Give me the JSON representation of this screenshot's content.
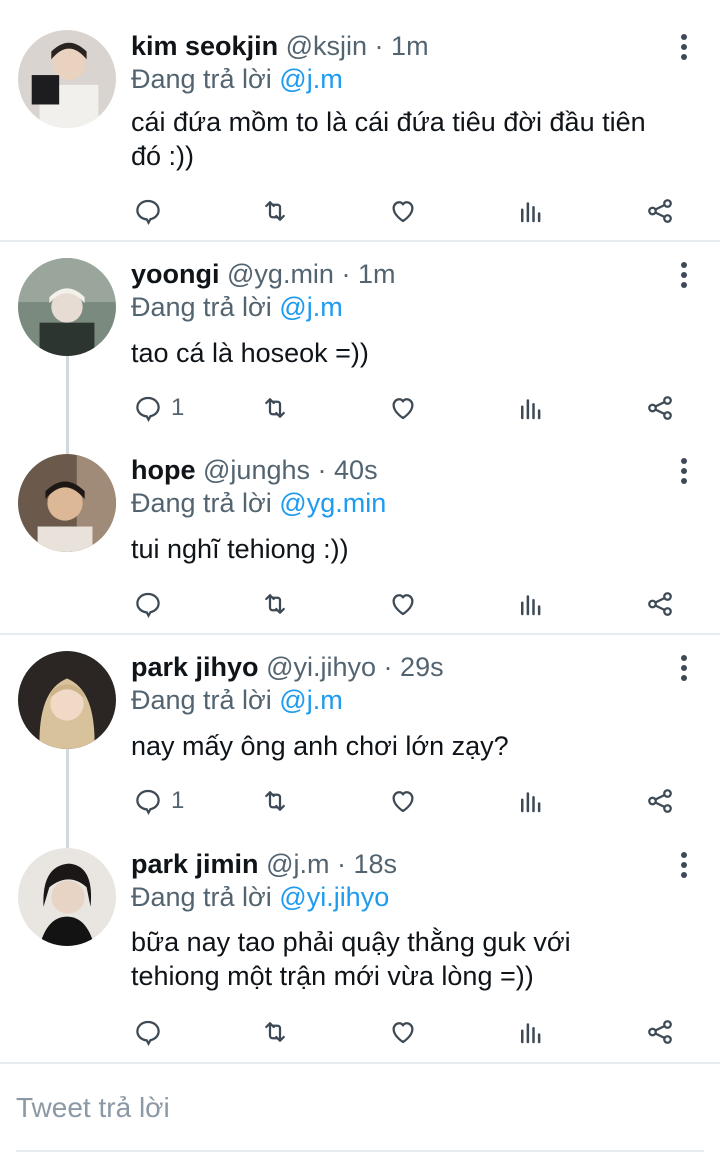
{
  "tweets": [
    {
      "name": "kim seokjin",
      "handle": "@ksjin",
      "time": "1m",
      "replying_prefix": "Đang trả lời",
      "replying_to": "@j.m",
      "body_lines": [
        "cái đứa mồm to là cái đứa tiêu đời đầu tiên",
        "đó :))"
      ],
      "reply_count": ""
    },
    {
      "name": "yoongi",
      "handle": "@yg.min",
      "time": "1m",
      "replying_prefix": "Đang trả lời",
      "replying_to": "@j.m",
      "body_lines": [
        "tao cá là hoseok =))"
      ],
      "reply_count": "1"
    },
    {
      "name": "hope",
      "handle": "@junghs",
      "time": "40s",
      "replying_prefix": "Đang trả lời",
      "replying_to": "@yg.min",
      "body_lines": [
        "tui nghĩ tehiong :))"
      ],
      "reply_count": ""
    },
    {
      "name": "park jihyo",
      "handle": "@yi.jihyo",
      "time": "29s",
      "replying_prefix": "Đang trả lời",
      "replying_to": "@j.m",
      "body_lines": [
        "nay mấy ông anh chơi lớn zạy?"
      ],
      "reply_count": "1"
    },
    {
      "name": "park jimin",
      "handle": "@j.m",
      "time": "18s",
      "replying_prefix": "Đang trả lời",
      "replying_to": "@yi.jihyo",
      "body_lines": [
        "bữa nay tao phải quậy thằng guk với",
        "tehiong một trận mới vừa lòng =))"
      ],
      "reply_count": ""
    }
  ],
  "reply_box": {
    "placeholder": "Tweet trả lời"
  },
  "icons": [
    "reply-icon",
    "retweet-icon",
    "like-icon",
    "views-icon",
    "share-icon",
    "more-icon"
  ],
  "colors": {
    "mention": "#1d9bf0",
    "meta": "#536471",
    "divider": "#e6ecf0"
  }
}
